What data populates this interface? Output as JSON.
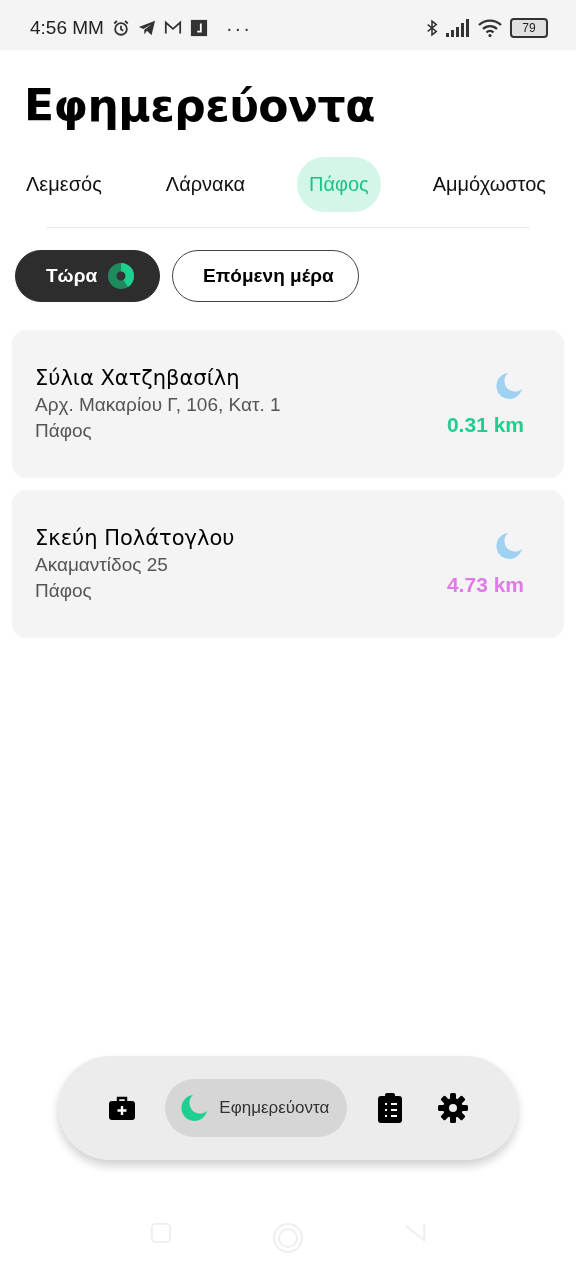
{
  "status_bar": {
    "time": "4:56 MM",
    "more": "···",
    "battery": "79"
  },
  "title": "Εφημερεύοντα",
  "tabs": [
    {
      "label": "Λεμεσός",
      "selected": false
    },
    {
      "label": "Λάρνακα",
      "selected": false
    },
    {
      "label": "Πάφος",
      "selected": true
    },
    {
      "label": "Αμμόχωστος",
      "selected": false
    }
  ],
  "filters": [
    {
      "label": "Τώρα",
      "selected": true,
      "kind": "now"
    },
    {
      "label": "Επόμενη μέρα",
      "selected": false,
      "kind": "next"
    }
  ],
  "pharmacies": [
    {
      "name": "Σύλια Χατζηβασίλη",
      "address": "Αρχ. Μακαρίου Γ, 106, Κατ. 1",
      "city": "Πάφος",
      "distance": "0.31 km",
      "color": "#1fcf8f"
    },
    {
      "name": "Σκεύη Πολάτογλου",
      "address": "Ακαμαντίδος 25",
      "city": "Πάφος",
      "distance": "4.73 km",
      "color": "#e07ae6"
    }
  ],
  "bottom_nav": [
    {
      "kind": "medkit",
      "selected": false
    },
    {
      "kind": "moon",
      "label": "Εφημερεύοντα",
      "selected": true
    },
    {
      "kind": "clipboard",
      "selected": false
    },
    {
      "kind": "settings",
      "selected": false
    }
  ]
}
